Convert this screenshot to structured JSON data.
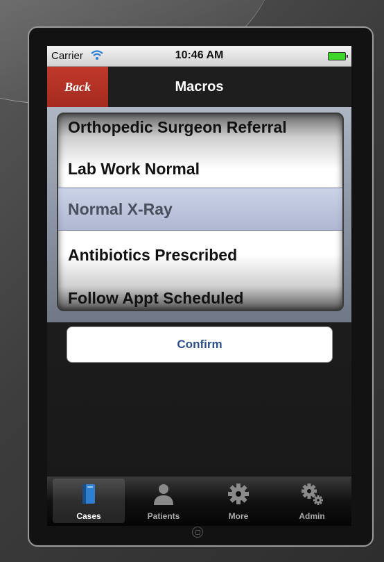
{
  "status_bar": {
    "carrier": "Carrier",
    "time": "10:46 AM"
  },
  "nav": {
    "back_label": "Back",
    "title": "Macros"
  },
  "picker": {
    "items": [
      "Orthopedic Surgeon Referral",
      "Lab Work Normal",
      "Normal X-Ray",
      "Antibiotics Prescribed",
      "Follow Appt Scheduled"
    ],
    "selected_index": 2
  },
  "confirm_label": "Confirm",
  "tabs": [
    {
      "label": "Cases",
      "icon": "book-icon",
      "active": true
    },
    {
      "label": "Patients",
      "icon": "person-icon",
      "active": false
    },
    {
      "label": "More",
      "icon": "gear-icon",
      "active": false
    },
    {
      "label": "Admin",
      "icon": "gears-icon",
      "active": false
    }
  ],
  "colors": {
    "back_button": "#b5352a",
    "confirm_text": "#2b4f8c",
    "battery": "#3ed62b"
  }
}
